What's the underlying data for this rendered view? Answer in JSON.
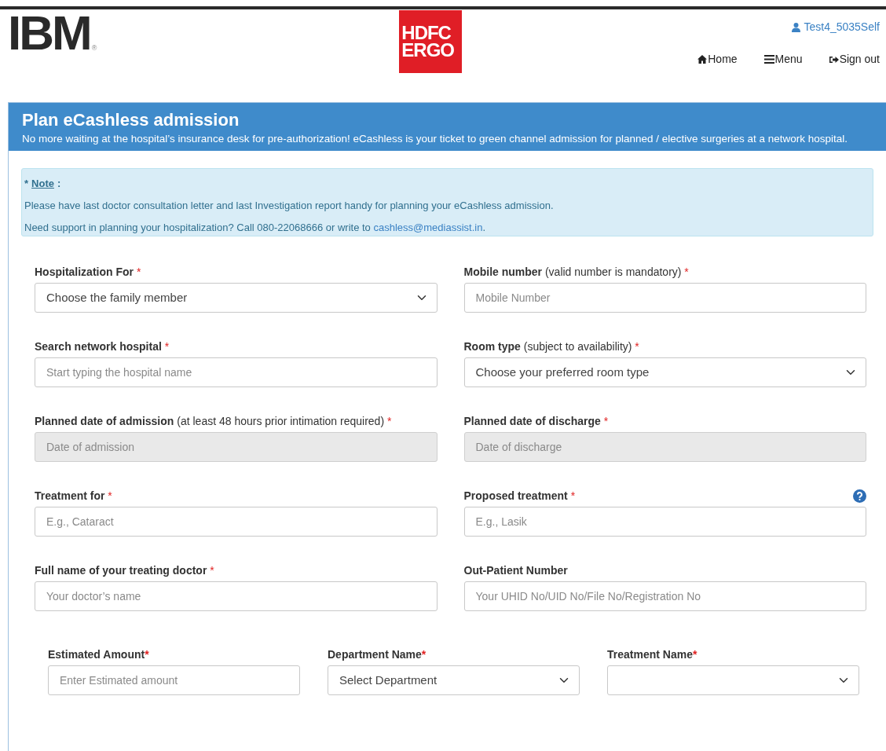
{
  "brand": {
    "ibm_logo": "IBM",
    "ibm_mark": "®",
    "partner_logo": [
      "HDFC",
      "ERGO"
    ]
  },
  "user": {
    "name": "Test4_5035Self"
  },
  "nav": [
    {
      "label": "Home",
      "kind": "home"
    },
    {
      "label": "Menu",
      "kind": "menu"
    },
    {
      "label": "Sign out",
      "kind": "signout"
    }
  ],
  "header": {
    "title": "Plan eCashless admission",
    "description": "No more waiting at the hospital’s insurance desk for pre-authorization! eCashless is your ticket to green channel admission for planned / elective surgeries at a network hospital."
  },
  "note": {
    "marker": "*",
    "title": "Note",
    "colon": ":",
    "lines": [
      {
        "text": "Please have last doctor consultation letter and last Investigation report handy for planning your eCashless admission."
      },
      {
        "text": "Need support in planning your hospitalization? Call 080-22068666 or write to ",
        "link": "cashless@mediassist.in",
        "after": "."
      }
    ]
  },
  "fields": [
    {
      "label": "Hospitalization For",
      "required": true,
      "kind": "select",
      "value": "Choose the family member",
      "disabled": false,
      "help": false
    },
    {
      "label": "Mobile number",
      "hint": "(valid number is mandatory)",
      "required": true,
      "kind": "input",
      "placeholder": "Mobile Number",
      "disabled": false,
      "help": false
    },
    {
      "label": "Search network hospital",
      "required": true,
      "kind": "input",
      "placeholder": "Start typing the hospital name",
      "disabled": false,
      "help": false
    },
    {
      "label": "Room type",
      "hint": "(subject to availability)",
      "required": true,
      "kind": "select",
      "value": "Choose your preferred room type",
      "disabled": false,
      "help": false
    },
    {
      "label": "Planned date of admission",
      "hint": "(at least 48 hours prior intimation required)",
      "required": true,
      "kind": "input",
      "placeholder": "Date of admission",
      "disabled": true,
      "help": false
    },
    {
      "label": "Planned date of discharge",
      "required": true,
      "kind": "input",
      "placeholder": "Date of discharge",
      "disabled": true,
      "help": false
    },
    {
      "label": "Treatment for",
      "required": true,
      "kind": "input",
      "placeholder": "E.g., Cataract",
      "disabled": false,
      "help": false
    },
    {
      "label": "Proposed treatment",
      "required": true,
      "kind": "input",
      "placeholder": "E.g., Lasik",
      "disabled": false,
      "help": true
    },
    {
      "label": "Full name of your treating doctor",
      "required": true,
      "kind": "input",
      "placeholder": "Your doctor’s name",
      "disabled": false,
      "help": false
    },
    {
      "label": "Out-Patient Number",
      "required": false,
      "kind": "input",
      "placeholder": "Your UHID No/UID No/File No/Registration No",
      "disabled": false,
      "help": false
    }
  ],
  "extra_fields": [
    {
      "label": "Estimated Amount",
      "required": true,
      "kind": "input",
      "placeholder": "Enter Estimated amount"
    },
    {
      "label": "Department Name",
      "required": true,
      "kind": "select",
      "value": "Select Department"
    },
    {
      "label": "Treatment Name",
      "required": true,
      "kind": "select"
    }
  ],
  "required_mark": "*"
}
